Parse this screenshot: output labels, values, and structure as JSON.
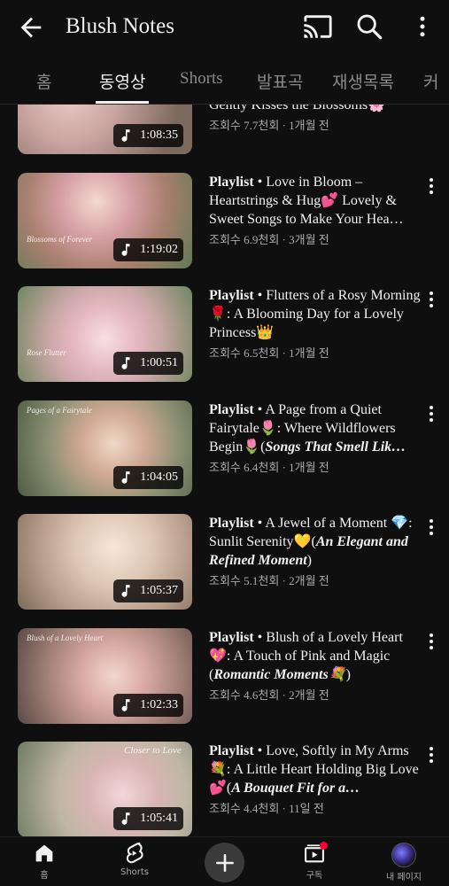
{
  "header": {
    "title": "Blush Notes",
    "back_icon": "arrow-back-icon",
    "cast_icon": "cast-icon",
    "search_icon": "search-icon",
    "more_icon": "more-vert-icon"
  },
  "tabs": [
    {
      "label": "홈"
    },
    {
      "label": "동영상"
    },
    {
      "label": "Shorts"
    },
    {
      "label": "발표곡"
    },
    {
      "label": "재생목록"
    },
    {
      "label": "커"
    }
  ],
  "active_tab": "동영상",
  "videos": [
    {
      "title_partial": "Gently Kisses the Blossoms🌸",
      "duration": "1:08:35",
      "meta": "조회수 7.7천회 · 1개월 전"
    },
    {
      "prefix": "Playlist",
      "sep": "•",
      "title": "Love in Bloom – Heartstrings & Hug💕 Lovely & Sweet Songs to Make Your Hea…",
      "thumb_caption": "Blossoms of Forever",
      "duration": "1:19:02",
      "meta": "조회수 6.9천회 · 3개월 전"
    },
    {
      "prefix": "Playlist",
      "sep": "•",
      "title": "Flutters of a Rosy Morning🌹: A Blooming Day for a Lovely Princess👑",
      "thumb_caption": "Rose Flutter",
      "duration": "1:00:51",
      "meta": "조회수 6.5천회 · 1개월 전"
    },
    {
      "prefix": "Playlist",
      "sep": "•",
      "title": "A Page from a Quiet Fairytale🌷: Where Wildflowers Begin🌷(",
      "title_bi": "Songs That Smell Lik…",
      "thumb_caption": "Pages of a Fairytale",
      "duration": "1:04:05",
      "meta": "조회수 6.4천회 · 1개월 전"
    },
    {
      "prefix": "Playlist",
      "sep": "•",
      "title": "A Jewel of a Moment 💎: Sunlit Serenity💛(",
      "title_bi": "An Elegant and Refined Moment",
      "title_tail": ")",
      "duration": "1:05:37",
      "meta": "조회수 5.1천회 · 2개월 전"
    },
    {
      "prefix": "Playlist",
      "sep": "•",
      "title": "Blush of a Lovely Heart💖: A Touch of Pink and Magic (",
      "title_bi": "Romantic Moments💐",
      "title_tail": ")",
      "thumb_caption": "Blush of a Lovely Heart",
      "duration": "1:02:33",
      "meta": "조회수 4.6천회 · 2개월 전"
    },
    {
      "prefix": "Playlist",
      "sep": "•",
      "title": "Love, Softly in My Arms💐: A Little Heart Holding Big Love💕(",
      "title_bi": "A Bouquet Fit for a…",
      "thumb_caption": "Closer to Love",
      "duration": "1:05:41",
      "meta": "조회수 4.4천회 · 11일 전"
    }
  ],
  "bottom_nav": [
    {
      "label": "홈",
      "icon": "home-icon"
    },
    {
      "label": "Shorts",
      "icon": "shorts-icon"
    },
    {
      "label": "",
      "icon": "create-plus-icon"
    },
    {
      "label": "구독",
      "icon": "subscriptions-icon"
    },
    {
      "label": "내 페이지",
      "icon": "avatar-icon"
    }
  ],
  "colors": {
    "background": "#0f0f0f",
    "text_primary": "#f1f1f1",
    "text_secondary": "#aaaaaa",
    "notification_dot": "#ff0033"
  }
}
